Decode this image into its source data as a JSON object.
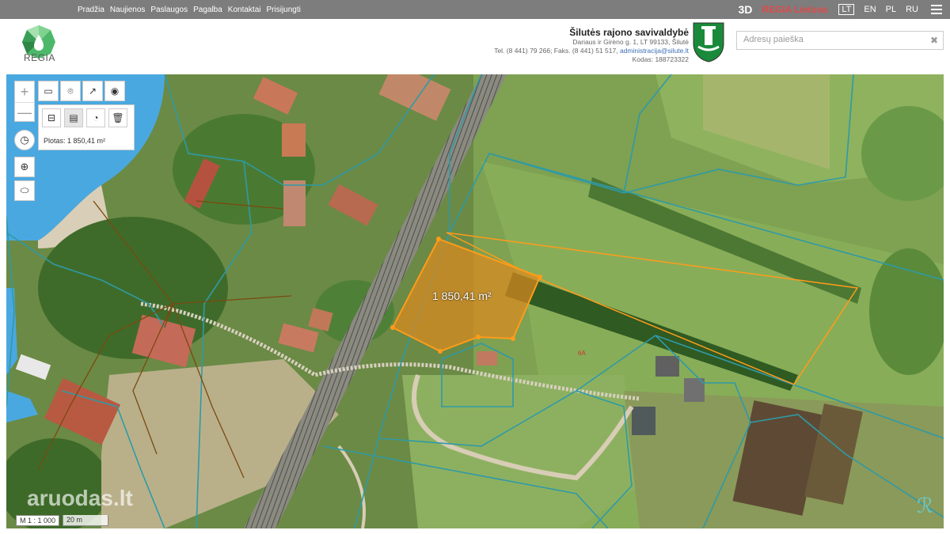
{
  "topbar": {
    "nav": [
      "Pradžia",
      "Naujienos",
      "Paslaugos",
      "Pagalba",
      "Kontaktai",
      "Prisijungti"
    ],
    "btn_3d": "3D",
    "regia_label": "REGIA Lietuva",
    "languages": [
      "LT",
      "EN",
      "PL",
      "RU"
    ],
    "active_language": "LT"
  },
  "header": {
    "logo_text": "REGIA",
    "muni_name": "Šilutės rajono savivaldybė",
    "address": "Dariaus ir Girėno g. 1, LT 99133, Šilutė",
    "phone_prefix": "Tel. (8 441) 79 266; Faks. (8 441) 51 517, ",
    "email": "administracija@silute.lt",
    "code": "Kodas: 188723322",
    "search_placeholder": "Adresų paieška",
    "search_clear": "✖"
  },
  "tools": {
    "zoom_in": "+",
    "zoom_out": "—",
    "area_label": "Plotas: 1 850,41 m²"
  },
  "map": {
    "polygon_label": "1 850,41 m²",
    "parcel_label": "6A",
    "scale_ratio": "M 1 : 1 000",
    "scale_bar": "20 m",
    "watermark": "aruodas.lt",
    "colors": {
      "parcel": "#2f9aa6",
      "measure": "#ff9c1a",
      "measure_fill": "#e08a1e",
      "line": "#7a4a10"
    }
  }
}
